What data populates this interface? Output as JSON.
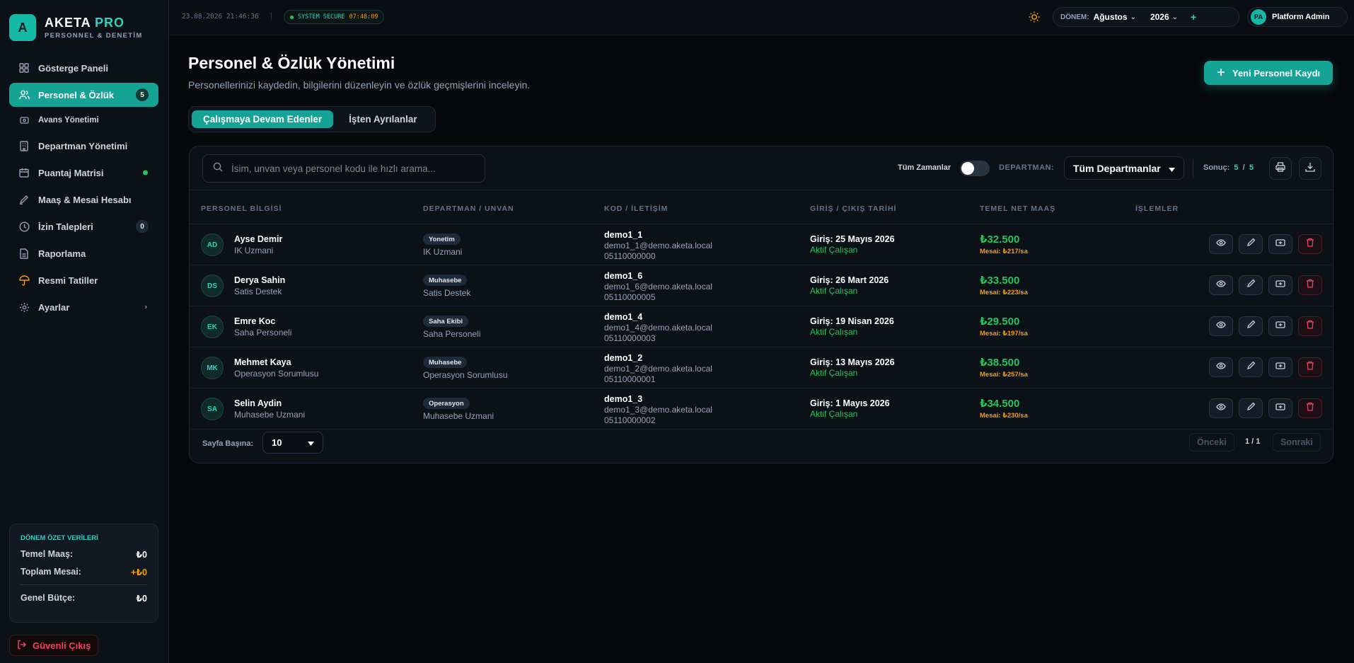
{
  "brand": {
    "logo_letter": "A",
    "name": "AKETA",
    "name_accent": "PRO",
    "subtitle": "PERSONNEL & DENETİM"
  },
  "sidebar": {
    "items": [
      {
        "label": "Gösterge Paneli",
        "icon": "dashboard-icon"
      },
      {
        "label": "Personel & Özlük",
        "icon": "users-icon",
        "badge": "5",
        "active": true
      },
      {
        "label": "Avans Yönetimi",
        "icon": "money-icon",
        "sub": true
      },
      {
        "label": "Departman Yönetimi",
        "icon": "building-icon"
      },
      {
        "label": "Puantaj Matrisi",
        "icon": "calendar-icon",
        "dot": true
      },
      {
        "label": "Maaş & Mesai Hesabı",
        "icon": "pen-icon"
      },
      {
        "label": "İzin Talepleri",
        "icon": "clock-icon",
        "badge": "0"
      },
      {
        "label": "Raporlama",
        "icon": "report-icon"
      },
      {
        "label": "Resmi Tatiller",
        "icon": "umbrella-icon"
      },
      {
        "label": "Ayarlar",
        "icon": "gear-icon",
        "chevron": "›"
      }
    ],
    "summary": {
      "title": "DÖNEM ÖZET VERİLERİ",
      "base_label": "Temel Maaş:",
      "base_value": "₺0",
      "overtime_label": "Toplam Mesai:",
      "overtime_value": "+₺0",
      "budget_label": "Genel Bütçe:",
      "budget_value": "₺0"
    },
    "logout": "Güvenli Çıkış"
  },
  "topbar": {
    "datetime": "23.08.2026 21:46:36",
    "separator": "|",
    "secure_label": "SYSTEM SECURE",
    "secure_time": "07:48:09",
    "period_label": "DÖNEM:",
    "month": "Ağustos",
    "year": "2026",
    "plus": "+",
    "user_initials": "PA",
    "user_name": "Platform Admin"
  },
  "page": {
    "title": "Personel & Özlük Yönetimi",
    "subtitle": "Personellerinizi kaydedin, bilgilerini düzenleyin ve özlük geçmişlerini inceleyin.",
    "new_button": "Yeni Personel Kaydı",
    "tabs": [
      "Çalışmaya Devam Edenler",
      "İşten Ayrılanlar"
    ]
  },
  "filters": {
    "search_placeholder": "İsim, unvan veya personel kodu ile hızlı arama...",
    "all_time_label": "Tüm Zamanlar",
    "all_time_on": false,
    "dept_label": "DEPARTMAN:",
    "dept_value": "Tüm Departmanlar",
    "result_label": "Sonuç:",
    "result_shown": "5",
    "result_sep": "/",
    "result_total": "5"
  },
  "table": {
    "headers": [
      "PERSONEL BİLGİSİ",
      "DEPARTMAN / UNVAN",
      "KOD / İLETİŞİM",
      "GİRİŞ / ÇIKIŞ TARİHİ",
      "TEMEL NET MAAŞ",
      "İŞLEMLER"
    ],
    "rows": [
      {
        "initials": "AD",
        "name": "Ayse Demir",
        "title": "IK Uzmani",
        "dept": "Yonetim",
        "role": "IK Uzmani",
        "code": "demo1_1",
        "email": "demo1_1@demo.aketa.local",
        "phone": "05110000000",
        "entry": "Giriş: 25 Mayıs 2026",
        "status": "Aktif Çalışan",
        "salary": "₺32.500",
        "overtime": "Mesai: ₺217/sa"
      },
      {
        "initials": "DS",
        "name": "Derya Sahin",
        "title": "Satis Destek",
        "dept": "Muhasebe",
        "role": "Satis Destek",
        "code": "demo1_6",
        "email": "demo1_6@demo.aketa.local",
        "phone": "05110000005",
        "entry": "Giriş: 26 Mart 2026",
        "status": "Aktif Çalışan",
        "salary": "₺33.500",
        "overtime": "Mesai: ₺223/sa"
      },
      {
        "initials": "EK",
        "name": "Emre Koc",
        "title": "Saha Personeli",
        "dept": "Saha Ekibi",
        "role": "Saha Personeli",
        "code": "demo1_4",
        "email": "demo1_4@demo.aketa.local",
        "phone": "05110000003",
        "entry": "Giriş: 19 Nisan 2026",
        "status": "Aktif Çalışan",
        "salary": "₺29.500",
        "overtime": "Mesai: ₺197/sa"
      },
      {
        "initials": "MK",
        "name": "Mehmet Kaya",
        "title": "Operasyon Sorumlusu",
        "dept": "Muhasebe",
        "role": "Operasyon Sorumlusu",
        "code": "demo1_2",
        "email": "demo1_2@demo.aketa.local",
        "phone": "05110000001",
        "entry": "Giriş: 13 Mayıs 2026",
        "status": "Aktif Çalışan",
        "salary": "₺38.500",
        "overtime": "Mesai: ₺257/sa"
      },
      {
        "initials": "SA",
        "name": "Selin Aydin",
        "title": "Muhasebe Uzmani",
        "dept": "Operasyon",
        "role": "Muhasebe Uzmani",
        "code": "demo1_3",
        "email": "demo1_3@demo.aketa.local",
        "phone": "05110000002",
        "entry": "Giriş: 1 Mayıs 2026",
        "status": "Aktif Çalışan",
        "salary": "₺34.500",
        "overtime": "Mesai: ₺230/sa"
      }
    ]
  },
  "pagination": {
    "per_page_label": "Sayfa Başına:",
    "per_page": "10",
    "prev": "Önceki",
    "page": "1 / 1",
    "next": "Sonraki"
  },
  "colors": {
    "accent": "#14a394",
    "bg": "#06080b",
    "success": "#22c55e",
    "warning": "#f59e0b",
    "danger": "#f43f5e"
  }
}
